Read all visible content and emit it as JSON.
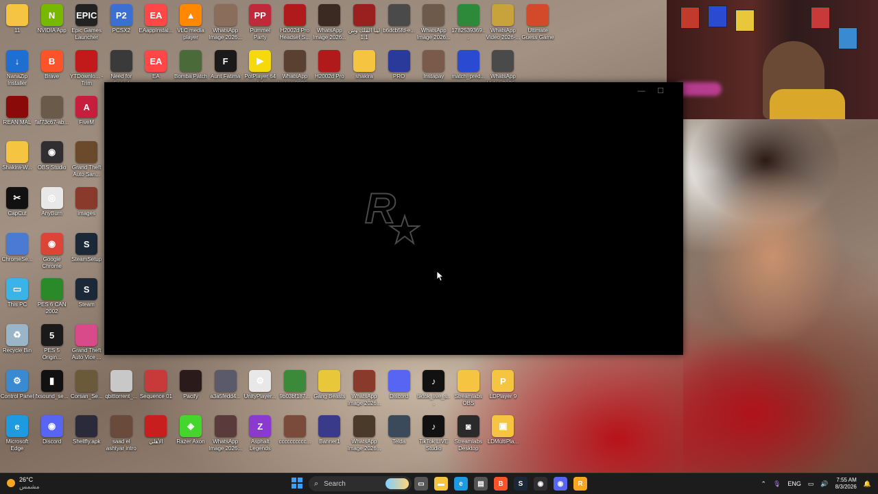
{
  "desktop": {
    "icons": [
      {
        "label": "11",
        "color": "#f5c542",
        "glyph": ""
      },
      {
        "label": "NVIDIA App",
        "color": "#76b900",
        "glyph": "N"
      },
      {
        "label": "Epic Games Launcher",
        "color": "#222222",
        "glyph": "EPIC"
      },
      {
        "label": "PCSX2",
        "color": "#3b6fd1",
        "glyph": "P2"
      },
      {
        "label": "EAappInstal...",
        "color": "#ff4747",
        "glyph": "EA"
      },
      {
        "label": "VLC media player",
        "color": "#ff8800",
        "glyph": "▲"
      },
      {
        "label": "WhatsApp Image 2026...",
        "color": "#8a6d5b",
        "glyph": ""
      },
      {
        "label": "Pummel Party",
        "color": "#c0293a",
        "glyph": "PP"
      },
      {
        "label": "H2002d Pro Headset S...",
        "color": "#b01a1a",
        "glyph": ""
      },
      {
        "label": "WhatsApp Image 2026...",
        "color": "#3a2a22",
        "glyph": ""
      },
      {
        "label": "لبنا الملك وش 1.1",
        "color": "#9a2020",
        "glyph": ""
      },
      {
        "label": "b6dcb5fd-e...",
        "color": "#4a4a4a",
        "glyph": ""
      },
      {
        "label": "WhatsApp Image 2026...",
        "color": "#6d5a4b",
        "glyph": ""
      },
      {
        "label": "1782539369...",
        "color": "#2d8a3a",
        "glyph": ""
      },
      {
        "label": "WhatsApp Video 2026-...",
        "color": "#c8a23a",
        "glyph": ""
      },
      {
        "label": "Ultimate Guess Game",
        "color": "#d24a2a",
        "glyph": ""
      },
      {
        "label": "NanaZip Installer",
        "color": "#1e6fd1",
        "glyph": "↓"
      },
      {
        "label": "Brave",
        "color": "#fb542b",
        "glyph": "B"
      },
      {
        "label": "YTDownlo... - Trim",
        "color": "#c21a1a",
        "glyph": ""
      },
      {
        "label": "Need for Speed",
        "color": "#3a3a3a",
        "glyph": ""
      },
      {
        "label": "EA",
        "color": "#ff4747",
        "glyph": "EA"
      },
      {
        "label": "Bomba Patch",
        "color": "#4a6a3a",
        "glyph": ""
      },
      {
        "label": "Aunt Fatima",
        "color": "#1a1a1a",
        "glyph": "F"
      },
      {
        "label": "PotPlayer 64 bit",
        "color": "#f5d90a",
        "glyph": "▶"
      },
      {
        "label": "WhatsApp Image 2026...",
        "color": "#5a4030",
        "glyph": ""
      },
      {
        "label": "H2002d Pro",
        "color": "#b01a1a",
        "glyph": ""
      },
      {
        "label": "shakira",
        "color": "#f5c542",
        "glyph": ""
      },
      {
        "label": "PRO",
        "color": "#2a3a9a",
        "glyph": ""
      },
      {
        "label": "Instapay",
        "color": "#7a5a4a",
        "glyph": ""
      },
      {
        "label": "match_pred...",
        "color": "#2a4ad1",
        "glyph": ""
      },
      {
        "label": "WhatsApp Video 2026...",
        "color": "#4a4a4a",
        "glyph": ""
      },
      {
        "label": "REAN MAL",
        "color": "#8a0a0a",
        "glyph": ""
      },
      {
        "label": "faf73c67-ab...",
        "color": "#6a5a4a",
        "glyph": ""
      },
      {
        "label": "FiveM",
        "color": "#c81e3e",
        "glyph": "A"
      },
      {
        "label": "Shakira-W...",
        "color": "#f5c542",
        "glyph": ""
      },
      {
        "label": "OBS Studio",
        "color": "#302e31",
        "glyph": "◉"
      },
      {
        "label": "Grand Theft Auto San...",
        "color": "#6a4a2a",
        "glyph": ""
      },
      {
        "label": "CapCut",
        "color": "#111111",
        "glyph": "✂"
      },
      {
        "label": "AnyBurn",
        "color": "#e8e8e8",
        "glyph": "◎"
      },
      {
        "label": "images",
        "color": "#8a3a2a",
        "glyph": ""
      },
      {
        "label": "ChromeSe...",
        "color": "#4a7ad1",
        "glyph": ""
      },
      {
        "label": "Google Chrome",
        "color": "#db4437",
        "glyph": "◉"
      },
      {
        "label": "SteamSetup",
        "color": "#1b2838",
        "glyph": "S"
      },
      {
        "label": "This PC",
        "color": "#3ab4e8",
        "glyph": "▭"
      },
      {
        "label": "PES 6 CAN 2002",
        "color": "#2a8a2a",
        "glyph": ""
      },
      {
        "label": "Steam",
        "color": "#1b2838",
        "glyph": "S"
      },
      {
        "label": "Recycle Bin",
        "color": "#9ab4c8",
        "glyph": "♻"
      },
      {
        "label": "PES 5 Origin...",
        "color": "#1a1a1a",
        "glyph": "5"
      },
      {
        "label": "Grand Theft Auto Vice ...",
        "color": "#d84a8a",
        "glyph": ""
      },
      {
        "label": "Control Panel",
        "color": "#3a8ad1",
        "glyph": "⚙"
      },
      {
        "label": "fxsound_se...",
        "color": "#111111",
        "glyph": "▮"
      },
      {
        "label": "Corsan_Se...",
        "color": "#6a5a3a",
        "glyph": ""
      },
      {
        "label": "qbittorrent_...",
        "color": "#c8c8c8",
        "glyph": ""
      },
      {
        "label": "Sequence 01",
        "color": "#c83a3a",
        "glyph": ""
      },
      {
        "label": "Pacify",
        "color": "#2a1a1a",
        "glyph": ""
      },
      {
        "label": "a3a5fedd4...",
        "color": "#5a5a6a",
        "glyph": ""
      },
      {
        "label": "UnityPlayer...",
        "color": "#e8e8e8",
        "glyph": "⚙"
      },
      {
        "label": "9b03bf187...",
        "color": "#3a8a3a",
        "glyph": ""
      },
      {
        "label": "Gang Beasts",
        "color": "#e8c83a",
        "glyph": ""
      },
      {
        "label": "WhatsApp Image 2026...",
        "color": "#8a3a2a",
        "glyph": ""
      },
      {
        "label": "Discord",
        "color": "#5865f2",
        "glyph": ""
      },
      {
        "label": "tiktok_live_s...",
        "color": "#111111",
        "glyph": "♪"
      },
      {
        "label": "Streamlabs OBS",
        "color": "#f5c542",
        "glyph": ""
      },
      {
        "label": "LDPlayer 9",
        "color": "#f5c542",
        "glyph": "P"
      },
      {
        "label": "Microsoft Edge",
        "color": "#1e9be0",
        "glyph": "e"
      },
      {
        "label": "Discord",
        "color": "#5865f2",
        "glyph": "◉"
      },
      {
        "label": "Shellfly.apk",
        "color": "#2a2a3a",
        "glyph": ""
      },
      {
        "label": "saad el ashtyar intro",
        "color": "#6a4a3a",
        "glyph": ""
      },
      {
        "label": "الأهلي",
        "color": "#c81e1e",
        "glyph": ""
      },
      {
        "label": "Razer Axon",
        "color": "#44d62c",
        "glyph": "◈"
      },
      {
        "label": "WhatsApp Image 2026...",
        "color": "#5a3a3a",
        "glyph": ""
      },
      {
        "label": "Asphalt Legends",
        "color": "#8a3ad1",
        "glyph": "Z"
      },
      {
        "label": "cccccccccc...",
        "color": "#7a4a3a",
        "glyph": ""
      },
      {
        "label": "Banner1",
        "color": "#3a3a8a",
        "glyph": ""
      },
      {
        "label": "WhatsApp Image 2026...",
        "color": "#4a3a2a",
        "glyph": ""
      },
      {
        "label": "Telda",
        "color": "#3a4a5a",
        "glyph": ""
      },
      {
        "label": "TikTok LIVE Studio",
        "color": "#111111",
        "glyph": "♪"
      },
      {
        "label": "Streamlabs Desktop",
        "color": "#2a2a2a",
        "glyph": "◙"
      },
      {
        "label": "LDMultiPla...",
        "color": "#f5c542",
        "glyph": "▣"
      }
    ]
  },
  "app_window": {
    "logo_letter": "R",
    "minimize_glyph": "—",
    "maximize_glyph": "☐"
  },
  "taskbar": {
    "weather_temp": "26°C",
    "weather_desc": "مشمس",
    "search_placeholder": "Search",
    "language": "ENG",
    "time": "7:55 AM",
    "date": "8/3/2026",
    "pinned": [
      {
        "name": "task-view",
        "color": "#555555",
        "glyph": "▭"
      },
      {
        "name": "file-explorer",
        "color": "#f5c542",
        "glyph": "▬"
      },
      {
        "name": "edge",
        "color": "#1e9be0",
        "glyph": "e"
      },
      {
        "name": "store",
        "color": "#555555",
        "glyph": "▤"
      },
      {
        "name": "brave",
        "color": "#fb542b",
        "glyph": "B"
      },
      {
        "name": "steam",
        "color": "#1b2838",
        "glyph": "S"
      },
      {
        "name": "obs",
        "color": "#302e31",
        "glyph": "◉"
      },
      {
        "name": "discord",
        "color": "#5865f2",
        "glyph": "◉"
      },
      {
        "name": "rockstar-launcher",
        "color": "#f5a623",
        "glyph": "R"
      }
    ]
  }
}
